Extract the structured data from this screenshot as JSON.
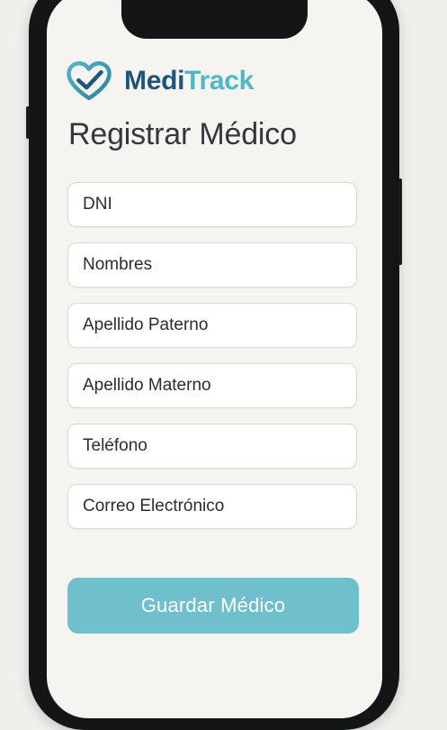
{
  "app": {
    "name_part1": "Medi",
    "name_part2": "Track",
    "logo_icon": "heart-check-icon"
  },
  "page": {
    "title": "Registrar Médico"
  },
  "form": {
    "fields": [
      {
        "placeholder": "DNI",
        "value": ""
      },
      {
        "placeholder": "Nombres",
        "value": ""
      },
      {
        "placeholder": "Apellido Paterno",
        "value": ""
      },
      {
        "placeholder": "Apellido Materno",
        "value": ""
      },
      {
        "placeholder": "Teléfono",
        "value": ""
      },
      {
        "placeholder": "Correo Electrónico",
        "value": ""
      }
    ],
    "submit_label": "Guardar Médico"
  },
  "colors": {
    "brand_dark": "#1f5578",
    "brand_accent": "#4fb7c8",
    "button": "#6fbfcc",
    "screen_bg": "#f6f4f0",
    "phone_frame": "#141516"
  }
}
